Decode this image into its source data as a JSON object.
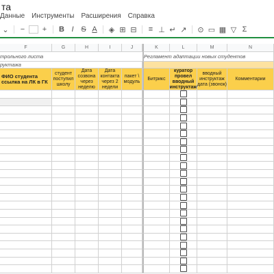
{
  "doc": {
    "title": "та"
  },
  "menu": [
    "Данные",
    "Инструменты",
    "Расширения",
    "Справка"
  ],
  "toolbar_icons": [
    "chevron-down-icon",
    "paint-format-icon",
    "bold-icon",
    "italic-icon",
    "strikethrough-icon",
    "text-color-icon",
    "fill-color-icon",
    "borders-icon",
    "merge-icon",
    "align-icon",
    "valign-icon",
    "wrap-icon",
    "rotate-icon",
    "link-icon",
    "comment-icon",
    "chart-icon",
    "filter-icon",
    "functions-icon"
  ],
  "columns": [
    "F",
    "G",
    "H",
    "I",
    "J",
    "K",
    "L",
    "M",
    "N"
  ],
  "sheet": {
    "row1_left": "трольного листа",
    "row1_right": "Регламент адаптации новых студентов",
    "row2_left": "руктажа",
    "headers": {
      "F": "ФИО студента ссылка на ЛК в ГК",
      "G": "студент поступил школу",
      "H": "Дата созвона через неделю",
      "I": "Дата контакта через 2 недели",
      "J": "пакет \\ модуль",
      "K": "Битрикс",
      "L": "куратор провел вводный инструктаж",
      "M": "вводный инструктаж дата (звонок)",
      "N": "Комментарии"
    }
  }
}
